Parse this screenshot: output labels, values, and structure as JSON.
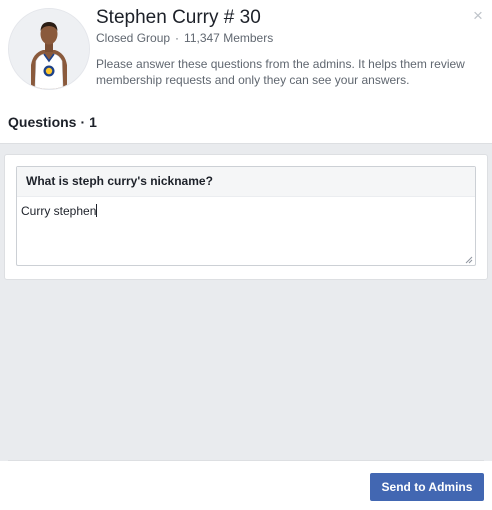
{
  "group": {
    "name": "Stephen Curry # 30",
    "privacy": "Closed Group",
    "separator": "·",
    "members": "11,347 Members"
  },
  "instructions": "Please answer these questions from the admins. It helps them review membership requests and only they can see your answers.",
  "close_icon": "×",
  "questions_section": {
    "label": "Questions",
    "separator": "·",
    "count": "1"
  },
  "questions": [
    {
      "prompt": "What is steph curry's nickname?",
      "answer": "Curry stephen"
    }
  ],
  "footer": {
    "send_label": "Send to Admins"
  },
  "colors": {
    "primary_button": "#4267b2",
    "body_background": "#e9ebee",
    "secondary_text": "#606770"
  },
  "icons": {
    "close": "close-icon",
    "avatar": "group-avatar",
    "resize": "resize-grip-icon"
  }
}
